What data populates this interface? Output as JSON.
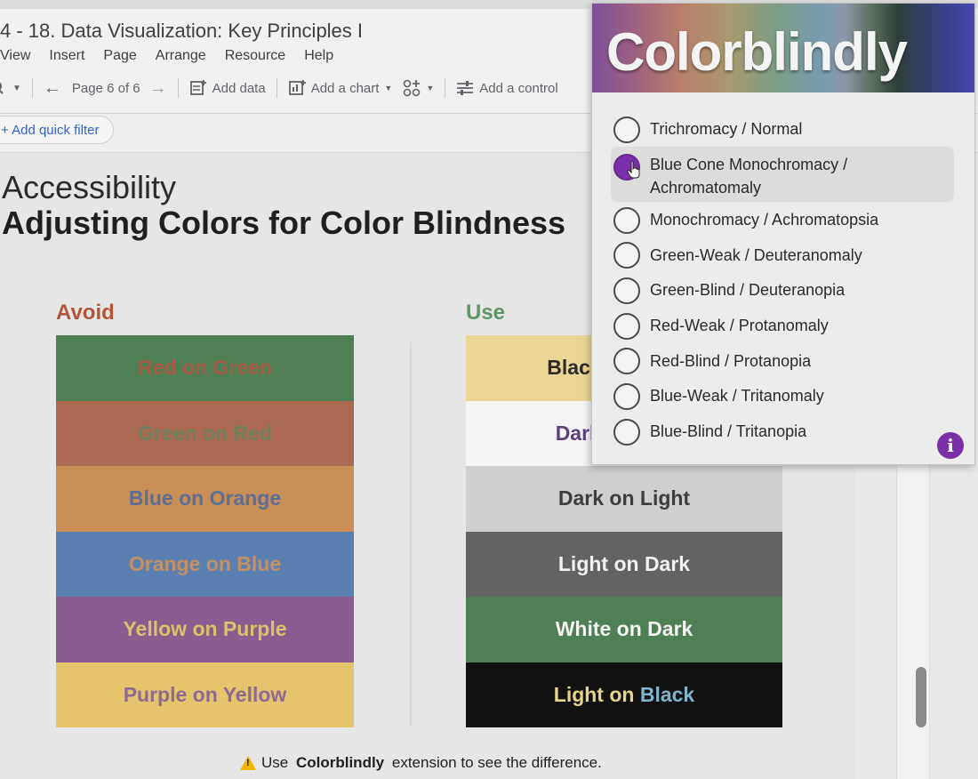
{
  "app": {
    "doc_title": "4 - 18. Data Visualization: Key Principles I",
    "menu": [
      "View",
      "Insert",
      "Page",
      "Arrange",
      "Resource",
      "Help"
    ],
    "toolbar": {
      "page_indicator": "Page 6 of 6",
      "add_data": "Add data",
      "add_chart": "Add a chart",
      "add_control": "Add a control"
    },
    "quick_filter": "+ Add quick filter"
  },
  "slide": {
    "subtitle": "Accessibility",
    "title": "Adjusting Colors for Color Blindness",
    "avoid_label": "Avoid",
    "use_label": "Use",
    "avoid_swatches": [
      {
        "text": "Red on Green",
        "bg": "#4f7f55",
        "fg": "#a85b48"
      },
      {
        "text": "Green on Red",
        "bg": "#ad6a52",
        "fg": "#6f8060"
      },
      {
        "text": "Blue on Orange",
        "bg": "#c98d56",
        "fg": "#5a6f97"
      },
      {
        "text": "Orange on Blue",
        "bg": "#5a7fb0",
        "fg": "#c38f63"
      },
      {
        "text": "Yellow on Purple",
        "bg": "#8a5c8f",
        "fg": "#dcc06a"
      },
      {
        "text": "Purple on Yellow",
        "bg": "#e6c46e",
        "fg": "#8d6a8f"
      }
    ],
    "use_swatches": [
      {
        "text": "Black on Yellow",
        "bg": "#e9d594",
        "fg": "#2a2a2a"
      },
      {
        "text": "Dark on White",
        "bg": "#f5f5f5",
        "fg": "#5d3f7a"
      },
      {
        "text": "Dark on Light",
        "bg": "#cfcfcf",
        "fg": "#3d3d3d"
      },
      {
        "text": "Light on Dark",
        "bg": "#636363",
        "fg": "#f1f1f1"
      },
      {
        "text": "White on Dark",
        "bg": "#4f7f55",
        "fg": "#f5f5f5"
      },
      {
        "text_a": "Light on ",
        "text_b": "Black",
        "bg": "#111111",
        "fg_a": "#e7d489",
        "fg_b": "#7fb4cf"
      }
    ],
    "footnote": {
      "prefix": "Use ",
      "brand": "Colorblindly",
      "suffix": " extension to see the difference."
    }
  },
  "extension": {
    "title": "Colorblindly",
    "options": [
      "Trichromacy / Normal",
      "Blue Cone Monochromacy / Achromatomaly",
      "Monochromacy / Achromatopsia",
      "Green-Weak / Deuteranomaly",
      "Green-Blind / Deuteranopia",
      "Red-Weak / Protanomaly",
      "Red-Blind / Protanopia",
      "Blue-Weak / Tritanomaly",
      "Blue-Blind / Tritanopia"
    ],
    "selected_index": 1,
    "accent": "#7b2fa8",
    "info_icon": "i"
  }
}
